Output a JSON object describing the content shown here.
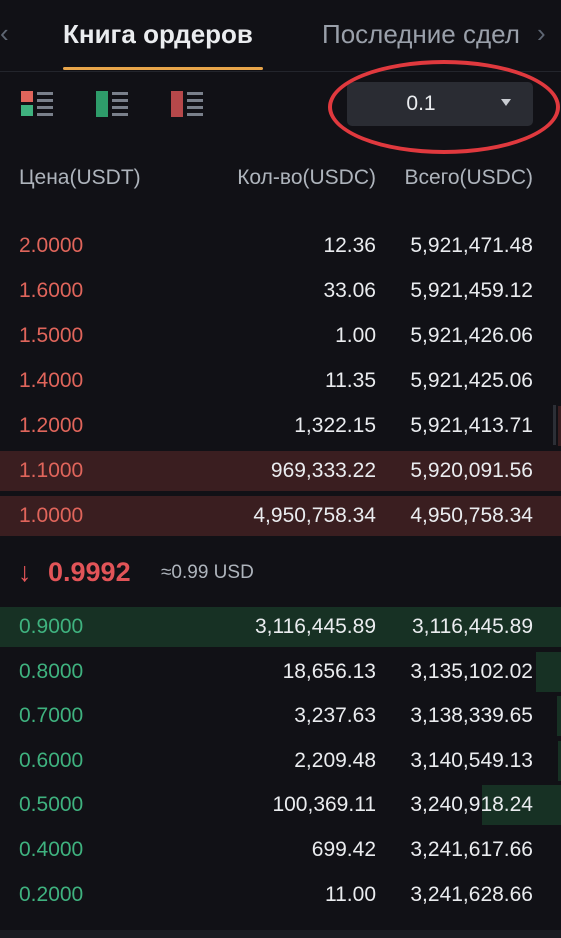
{
  "tabs": {
    "left_arrow": "‹",
    "right_arrow": "›",
    "active": "Книга ордеров",
    "inactive": "Последние сделки"
  },
  "view_modes": [
    {
      "icon": "split-book-icon"
    },
    {
      "icon": "bids-only-icon"
    },
    {
      "icon": "asks-only-icon"
    }
  ],
  "depth": {
    "value": "0.1",
    "caret_icon": "caret-down-icon"
  },
  "headers": {
    "price": "Цена(USDT)",
    "qty": "Кол-во(USDC)",
    "total": "Всего(USDC)"
  },
  "asks": [
    {
      "price": "2.0000",
      "qty": "12.36",
      "total": "5,921,471.48",
      "depth": 0
    },
    {
      "price": "1.6000",
      "qty": "33.06",
      "total": "5,921,459.12",
      "depth": 0
    },
    {
      "price": "1.5000",
      "qty": "1.00",
      "total": "5,921,426.06",
      "depth": 0
    },
    {
      "price": "1.4000",
      "qty": "11.35",
      "total": "5,921,425.06",
      "depth": 0
    },
    {
      "price": "1.2000",
      "qty": "1,322.15",
      "total": "5,921,413.71",
      "depth": 0.005
    },
    {
      "price": "1.1000",
      "qty": "969,333.22",
      "total": "5,920,091.56",
      "depth": 1.0
    },
    {
      "price": "1.0000",
      "qty": "4,950,758.34",
      "total": "4,950,758.34",
      "depth": 1.0
    }
  ],
  "last_price": {
    "arrow": "🡓",
    "value": "0.9992",
    "usd": "≈0.99 USD"
  },
  "bids": [
    {
      "price": "0.9000",
      "qty": "3,116,445.89",
      "total": "3,116,445.89",
      "depth": 1.0
    },
    {
      "price": "0.8000",
      "qty": "18,656.13",
      "total": "3,135,102.02",
      "depth": 0.045
    },
    {
      "price": "0.7000",
      "qty": "3,237.63",
      "total": "3,138,339.65",
      "depth": 0.007
    },
    {
      "price": "0.6000",
      "qty": "2,209.48",
      "total": "3,140,549.13",
      "depth": 0.005
    },
    {
      "price": "0.5000",
      "qty": "100,369.11",
      "total": "3,240,918.24",
      "depth": 0.14
    },
    {
      "price": "0.4000",
      "qty": "699.42",
      "total": "3,241,617.66",
      "depth": 0
    },
    {
      "price": "0.2000",
      "qty": "11.00",
      "total": "3,241,628.66",
      "depth": 0
    }
  ],
  "colors": {
    "ask": "#e0655b",
    "bid": "#3fb27f",
    "accent": "#e8a54a",
    "highlight": "#e0393e"
  }
}
